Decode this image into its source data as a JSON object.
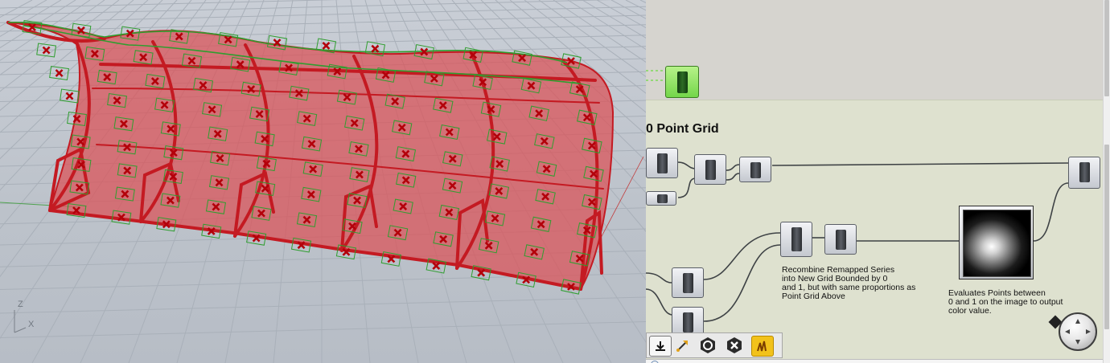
{
  "viewport": {
    "axis_z_label": "Z",
    "axis_x_label": "X",
    "grid_color": "#a6adb6",
    "background_color": "#bdc3cb",
    "surface_color": "#d94b52",
    "edge_color": "#c41a22",
    "point_marker_color": "#b3000a",
    "green_curve_color": "#2f9e2f",
    "icon": "red-surface-with-point-grid"
  },
  "grasshopper": {
    "group_title": "0 Point Grid",
    "notes": {
      "recombine": "Recombine Remapped Series\ninto New Grid Bounded by 0\nand 1, but with same proportions as\nPoint Grid Above",
      "evaluates": "Evaluates Points between\n0 and 1 on the image to output\ncolor value."
    },
    "group_color": "#dee1cf",
    "canvas_color": "#d6d4cf",
    "toolbar": {
      "buttons": [
        "download-icon",
        "arrow-pick-icon",
        "preview-toggle-icon",
        "delete-icon",
        "bake-icon"
      ]
    }
  }
}
